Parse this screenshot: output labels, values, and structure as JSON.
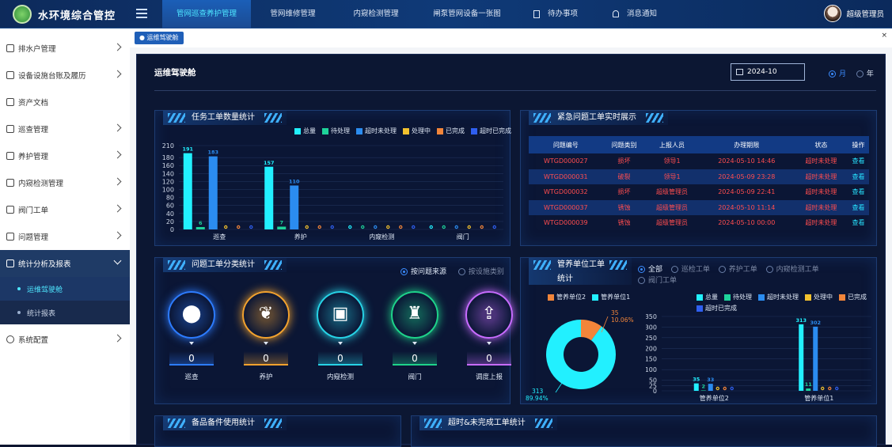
{
  "header": {
    "app_title": "水环境综合管控",
    "nav_tabs": [
      "管网巡查养护管理",
      "管网维修管理",
      "内窥检测管理",
      "闸泵管网设备一张图",
      "待办事项",
      "消息通知"
    ],
    "user_name": "超级管理员"
  },
  "sidebar": {
    "items": [
      {
        "label": "排水户管理"
      },
      {
        "label": "设备设施台账及履历"
      },
      {
        "label": "资产文档"
      },
      {
        "label": "巡查管理"
      },
      {
        "label": "养护管理"
      },
      {
        "label": "内窥检测管理"
      },
      {
        "label": "阀门工单"
      },
      {
        "label": "问题管理"
      },
      {
        "label": "统计分析及报表"
      },
      {
        "label": "系统配置"
      }
    ],
    "subitems": [
      {
        "label": "运维驾驶舱"
      },
      {
        "label": "统计报表"
      }
    ]
  },
  "tagbar": {
    "active_tag": "运维驾驶舱",
    "close_symbol": "×"
  },
  "board": {
    "title": "运维驾驶舱",
    "date_value": "2024-10",
    "period_options": [
      "月",
      "年"
    ]
  },
  "task_panel": {
    "title": "任务工单数量统计",
    "legend": [
      "总量",
      "待处理",
      "超时未处理",
      "处理中",
      "已完成",
      "超时已完成"
    ],
    "colors": [
      "#22f0ff",
      "#1ed39a",
      "#2b8cf0",
      "#f2c12e",
      "#f2853a",
      "#2f5ff0"
    ]
  },
  "urgent_panel": {
    "title": "紧急问题工单实时展示",
    "columns": [
      "问题编号",
      "问题类别",
      "上报人员",
      "办理期限",
      "状态",
      "操作"
    ],
    "rows": [
      [
        "WTGD000027",
        "损坏",
        "领导1",
        "2024-05-10 14:46",
        "超时未处理",
        "查看"
      ],
      [
        "WTGD000031",
        "破裂",
        "领导1",
        "2024-05-09 23:28",
        "超时未处理",
        "查看"
      ],
      [
        "WTGD000032",
        "损坏",
        "超级管理员",
        "2024-05-09 22:41",
        "超时未处理",
        "查看"
      ],
      [
        "WTGD000037",
        "锈蚀",
        "超级管理员",
        "2024-05-10 11:14",
        "超时未处理",
        "查看"
      ],
      [
        "WTGD000039",
        "锈蚀",
        "超级管理员",
        "2024-05-10 00:00",
        "超时未处理",
        "查看"
      ]
    ]
  },
  "problem_panel": {
    "title": "问题工单分类统计",
    "filters": [
      "按问题来源",
      "按设施类别"
    ],
    "categories": [
      {
        "label": "巡查",
        "value": "0",
        "color": "#2d7cff",
        "glyph": "⬤"
      },
      {
        "label": "养护",
        "value": "0",
        "color": "#f2a22e",
        "glyph": "❦"
      },
      {
        "label": "内窥检测",
        "value": "0",
        "color": "#27d3e6",
        "glyph": "▣"
      },
      {
        "label": "阀门",
        "value": "0",
        "color": "#1ed38a",
        "glyph": "♜"
      },
      {
        "label": "调度上报",
        "value": "0",
        "color": "#c86cff",
        "glyph": "⇪"
      }
    ]
  },
  "unit_panel": {
    "title": "管养单位工单统计",
    "filters": [
      "全部",
      "巡检工单",
      "养护工单",
      "内窥检测工单",
      "阀门工单"
    ],
    "pie_legend": [
      "管养单位2",
      "管养单位1"
    ],
    "pie_labels": [
      {
        "count": "35",
        "pct": "10.06%"
      },
      {
        "count": "313",
        "pct": "89.94%"
      }
    ],
    "bar_legend": [
      "总量",
      "待处理",
      "超时未处理",
      "处理中",
      "已完成",
      "超时已完成"
    ]
  },
  "spare_panel": {
    "title": "备品备件使用统计"
  },
  "overtime_panel": {
    "title": "超时&未完成工单统计"
  },
  "chart_data": [
    {
      "type": "bar",
      "title": "任务工单数量统计",
      "categories": [
        "巡查",
        "养护",
        "内窥检测",
        "阀门"
      ],
      "ylim": [
        0,
        210
      ],
      "yticks": [
        0,
        20,
        40,
        60,
        80,
        100,
        120,
        140,
        160,
        180,
        210
      ],
      "series": [
        {
          "name": "总量",
          "values": [
            191,
            157,
            0,
            0
          ]
        },
        {
          "name": "待处理",
          "values": [
            6,
            7,
            0,
            0
          ]
        },
        {
          "name": "超时未处理",
          "values": [
            183,
            110,
            0,
            0
          ]
        },
        {
          "name": "处理中",
          "values": [
            0,
            0,
            0,
            0
          ]
        },
        {
          "name": "已完成",
          "values": [
            0,
            0,
            0,
            0
          ]
        },
        {
          "name": "超时已完成",
          "values": [
            0,
            0,
            0,
            0
          ]
        }
      ]
    },
    {
      "type": "pie",
      "title": "管养单位工单统计",
      "categories": [
        "管养单位2",
        "管养单位1"
      ],
      "values": [
        35,
        313
      ]
    },
    {
      "type": "bar",
      "title": "管养单位工单统计",
      "categories": [
        "管养单位2",
        "管养单位1"
      ],
      "ylim": [
        0,
        350
      ],
      "yticks": [
        0,
        25,
        50,
        100,
        150,
        200,
        250,
        300,
        350
      ],
      "series": [
        {
          "name": "总量",
          "values": [
            35,
            313
          ]
        },
        {
          "name": "待处理",
          "values": [
            2,
            11
          ]
        },
        {
          "name": "超时未处理",
          "values": [
            33,
            302
          ]
        },
        {
          "name": "处理中",
          "values": [
            0,
            0
          ]
        },
        {
          "name": "已完成",
          "values": [
            0,
            0
          ]
        },
        {
          "name": "超时已完成",
          "values": [
            0,
            0
          ]
        }
      ]
    }
  ]
}
